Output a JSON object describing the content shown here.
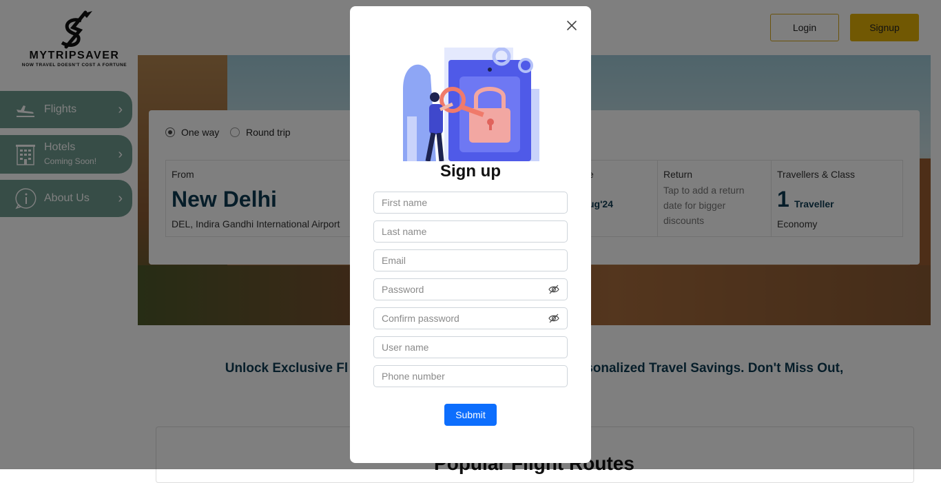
{
  "brand": {
    "name": "MYTRIPSAVER",
    "tagline": "NOW TRAVEL DOESN'T COST A FORTUNE"
  },
  "header": {
    "login_label": "Login",
    "signup_label": "Signup"
  },
  "sidebar": {
    "items": [
      {
        "label": "Flights",
        "sub": "",
        "icon": "plane-icon"
      },
      {
        "label": "Hotels",
        "sub": "Coming Soon!",
        "icon": "hotel-icon"
      },
      {
        "label": "About Us",
        "sub": "",
        "icon": "info-icon"
      }
    ]
  },
  "search": {
    "trip_types": [
      "One way",
      "Round trip"
    ],
    "selected_trip_type": "One way",
    "from": {
      "caption": "From",
      "city": "New Delhi",
      "airport": "DEL, Indira Gandhi International Airport"
    },
    "departure": {
      "caption_partial": "e",
      "date_partial": "ug'24"
    },
    "return": {
      "caption": "Return",
      "hint": "Tap to add a return date for bigger discounts"
    },
    "travellers": {
      "caption": "Travellers & Class",
      "count": "1",
      "unit": "Traveller",
      "class": "Economy"
    }
  },
  "promo": {
    "left": "Unlock Exclusive Fl",
    "right": "sonalized Travel Savings. Don't Miss Out,"
  },
  "routes": {
    "title": "Popular Flight Routes"
  },
  "modal": {
    "title": "Sign up",
    "fields": {
      "first_name": "First name",
      "last_name": "Last name",
      "email": "Email",
      "password": "Password",
      "confirm_password": "Confirm password",
      "user_name": "User name",
      "phone": "Phone number"
    },
    "submit_label": "Submit"
  },
  "colors": {
    "accent_gold": "#e2b106",
    "sidebar_green": "#6e9a8f",
    "primary_blue": "#0d6efd",
    "navy_text": "#0d3b52"
  }
}
